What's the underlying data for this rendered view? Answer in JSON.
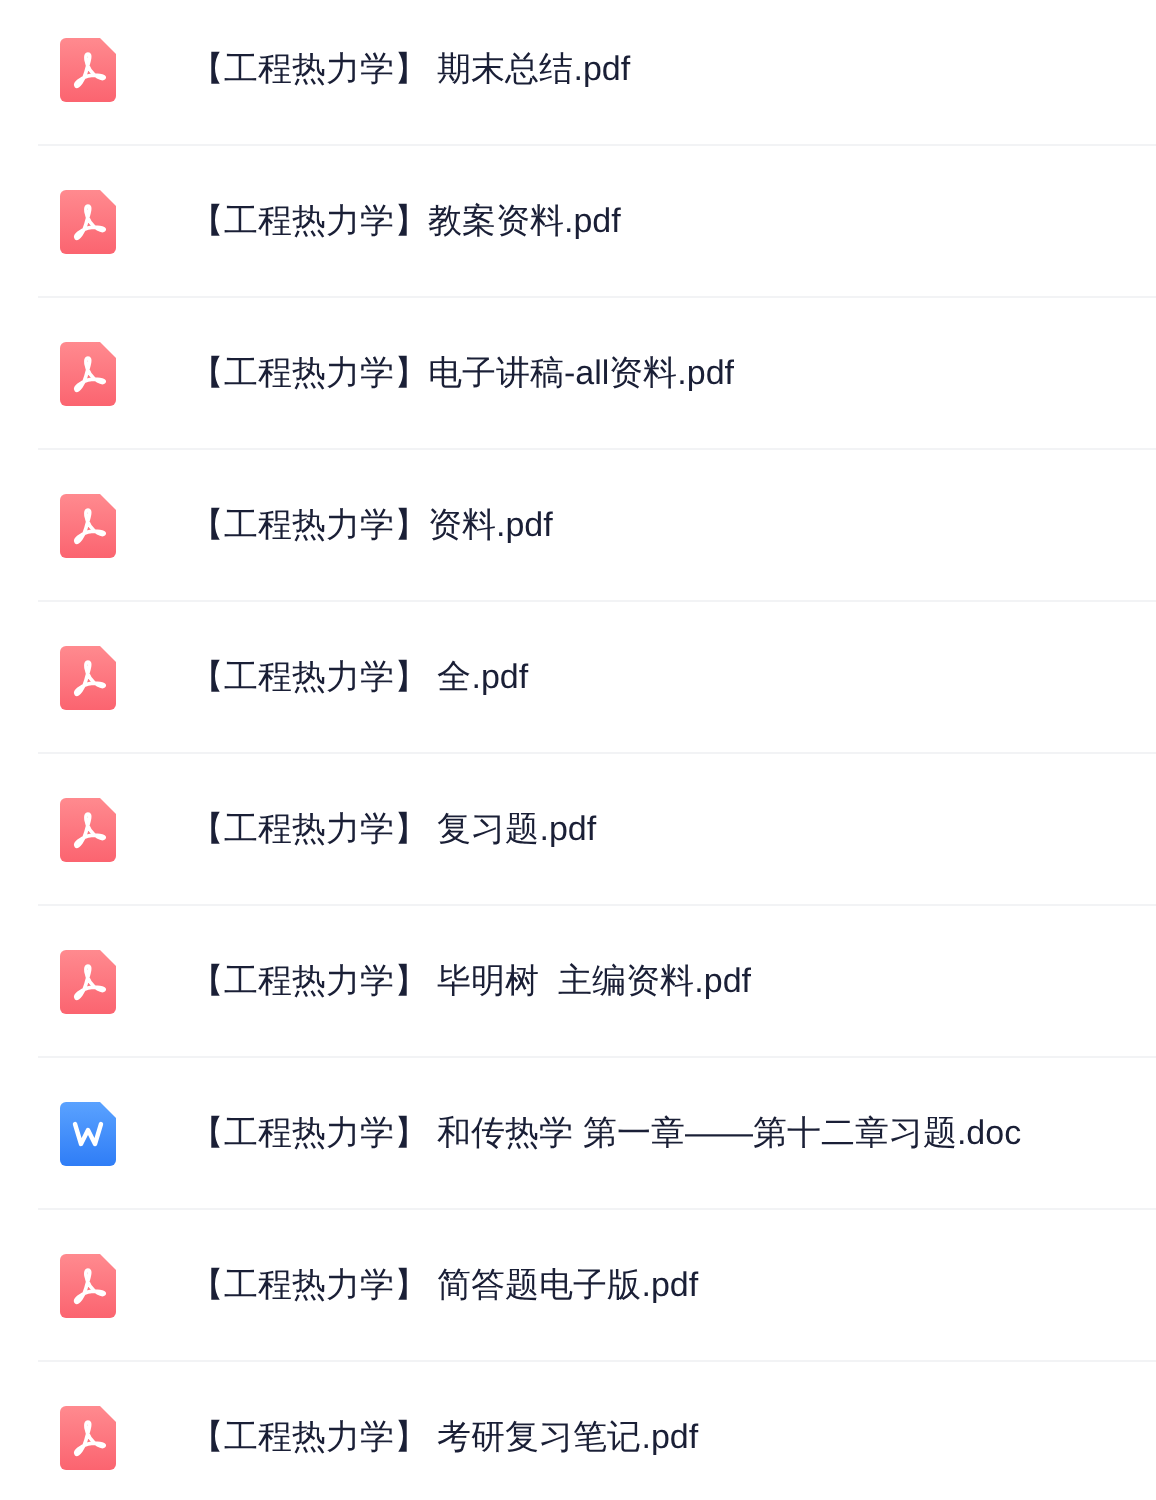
{
  "files": [
    {
      "kind": "pdf",
      "name": "【工程热力学】 期末总结.pdf"
    },
    {
      "kind": "pdf",
      "name": "【工程热力学】教案资料.pdf"
    },
    {
      "kind": "pdf",
      "name": "【工程热力学】电子讲稿-all资料.pdf"
    },
    {
      "kind": "pdf",
      "name": "【工程热力学】资料.pdf"
    },
    {
      "kind": "pdf",
      "name": "【工程热力学】 全.pdf"
    },
    {
      "kind": "pdf",
      "name": "【工程热力学】 复习题.pdf"
    },
    {
      "kind": "pdf",
      "name": "【工程热力学】 毕明树  主编资料.pdf"
    },
    {
      "kind": "doc",
      "name": "【工程热力学】 和传热学 第一章——第十二章习题.doc"
    },
    {
      "kind": "pdf",
      "name": "【工程热力学】 简答题电子版.pdf"
    },
    {
      "kind": "pdf",
      "name": "【工程热力学】 考研复习笔记.pdf"
    }
  ]
}
